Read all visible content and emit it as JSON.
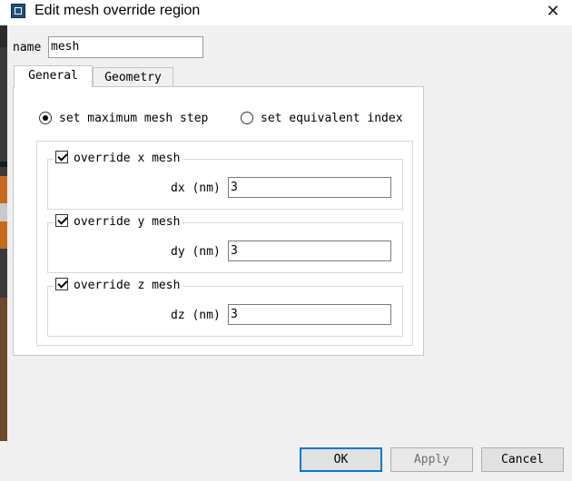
{
  "window": {
    "title": "Edit mesh override region",
    "close_glyph": "✕",
    "icon": "window-app-icon"
  },
  "name_field": {
    "label": "name",
    "value": "mesh"
  },
  "tabs": [
    {
      "label": "General",
      "selected": true
    },
    {
      "label": "Geometry",
      "selected": false
    }
  ],
  "mesh_mode": {
    "options": [
      {
        "label": "set maximum mesh step",
        "selected": true
      },
      {
        "label": "set equivalent index",
        "selected": false
      }
    ]
  },
  "overrides": [
    {
      "label": "override x mesh",
      "checked": true,
      "field_label": "dx (nm)",
      "value": "3"
    },
    {
      "label": "override y mesh",
      "checked": true,
      "field_label": "dy (nm)",
      "value": "3"
    },
    {
      "label": "override z mesh",
      "checked": true,
      "field_label": "dz (nm)",
      "value": "3"
    }
  ],
  "buttons": {
    "ok": "OK",
    "apply": "Apply",
    "cancel": "Cancel"
  },
  "colors": {
    "focus_border": "#0078d7",
    "dialog_bg": "#f0f0f0",
    "panel_bg": "#ffffff"
  }
}
